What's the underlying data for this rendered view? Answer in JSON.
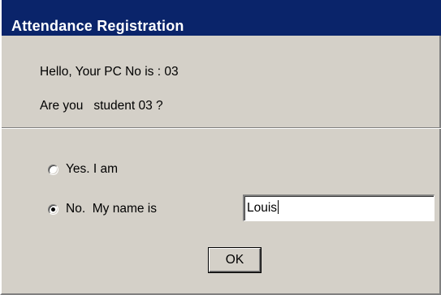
{
  "window": {
    "title": "Attendance Registration"
  },
  "message": {
    "line1": "Hello, Your PC No is : 03",
    "line2": "Are you   student 03 ?"
  },
  "options": {
    "yes_label": "Yes. I am",
    "yes_selected": false,
    "no_label": "No.  My name is",
    "no_selected": true
  },
  "name_field": {
    "value": "Louis"
  },
  "buttons": {
    "ok_label": "OK"
  },
  "colors": {
    "titlebar": "#0a246a",
    "face": "#d4d0c8"
  }
}
